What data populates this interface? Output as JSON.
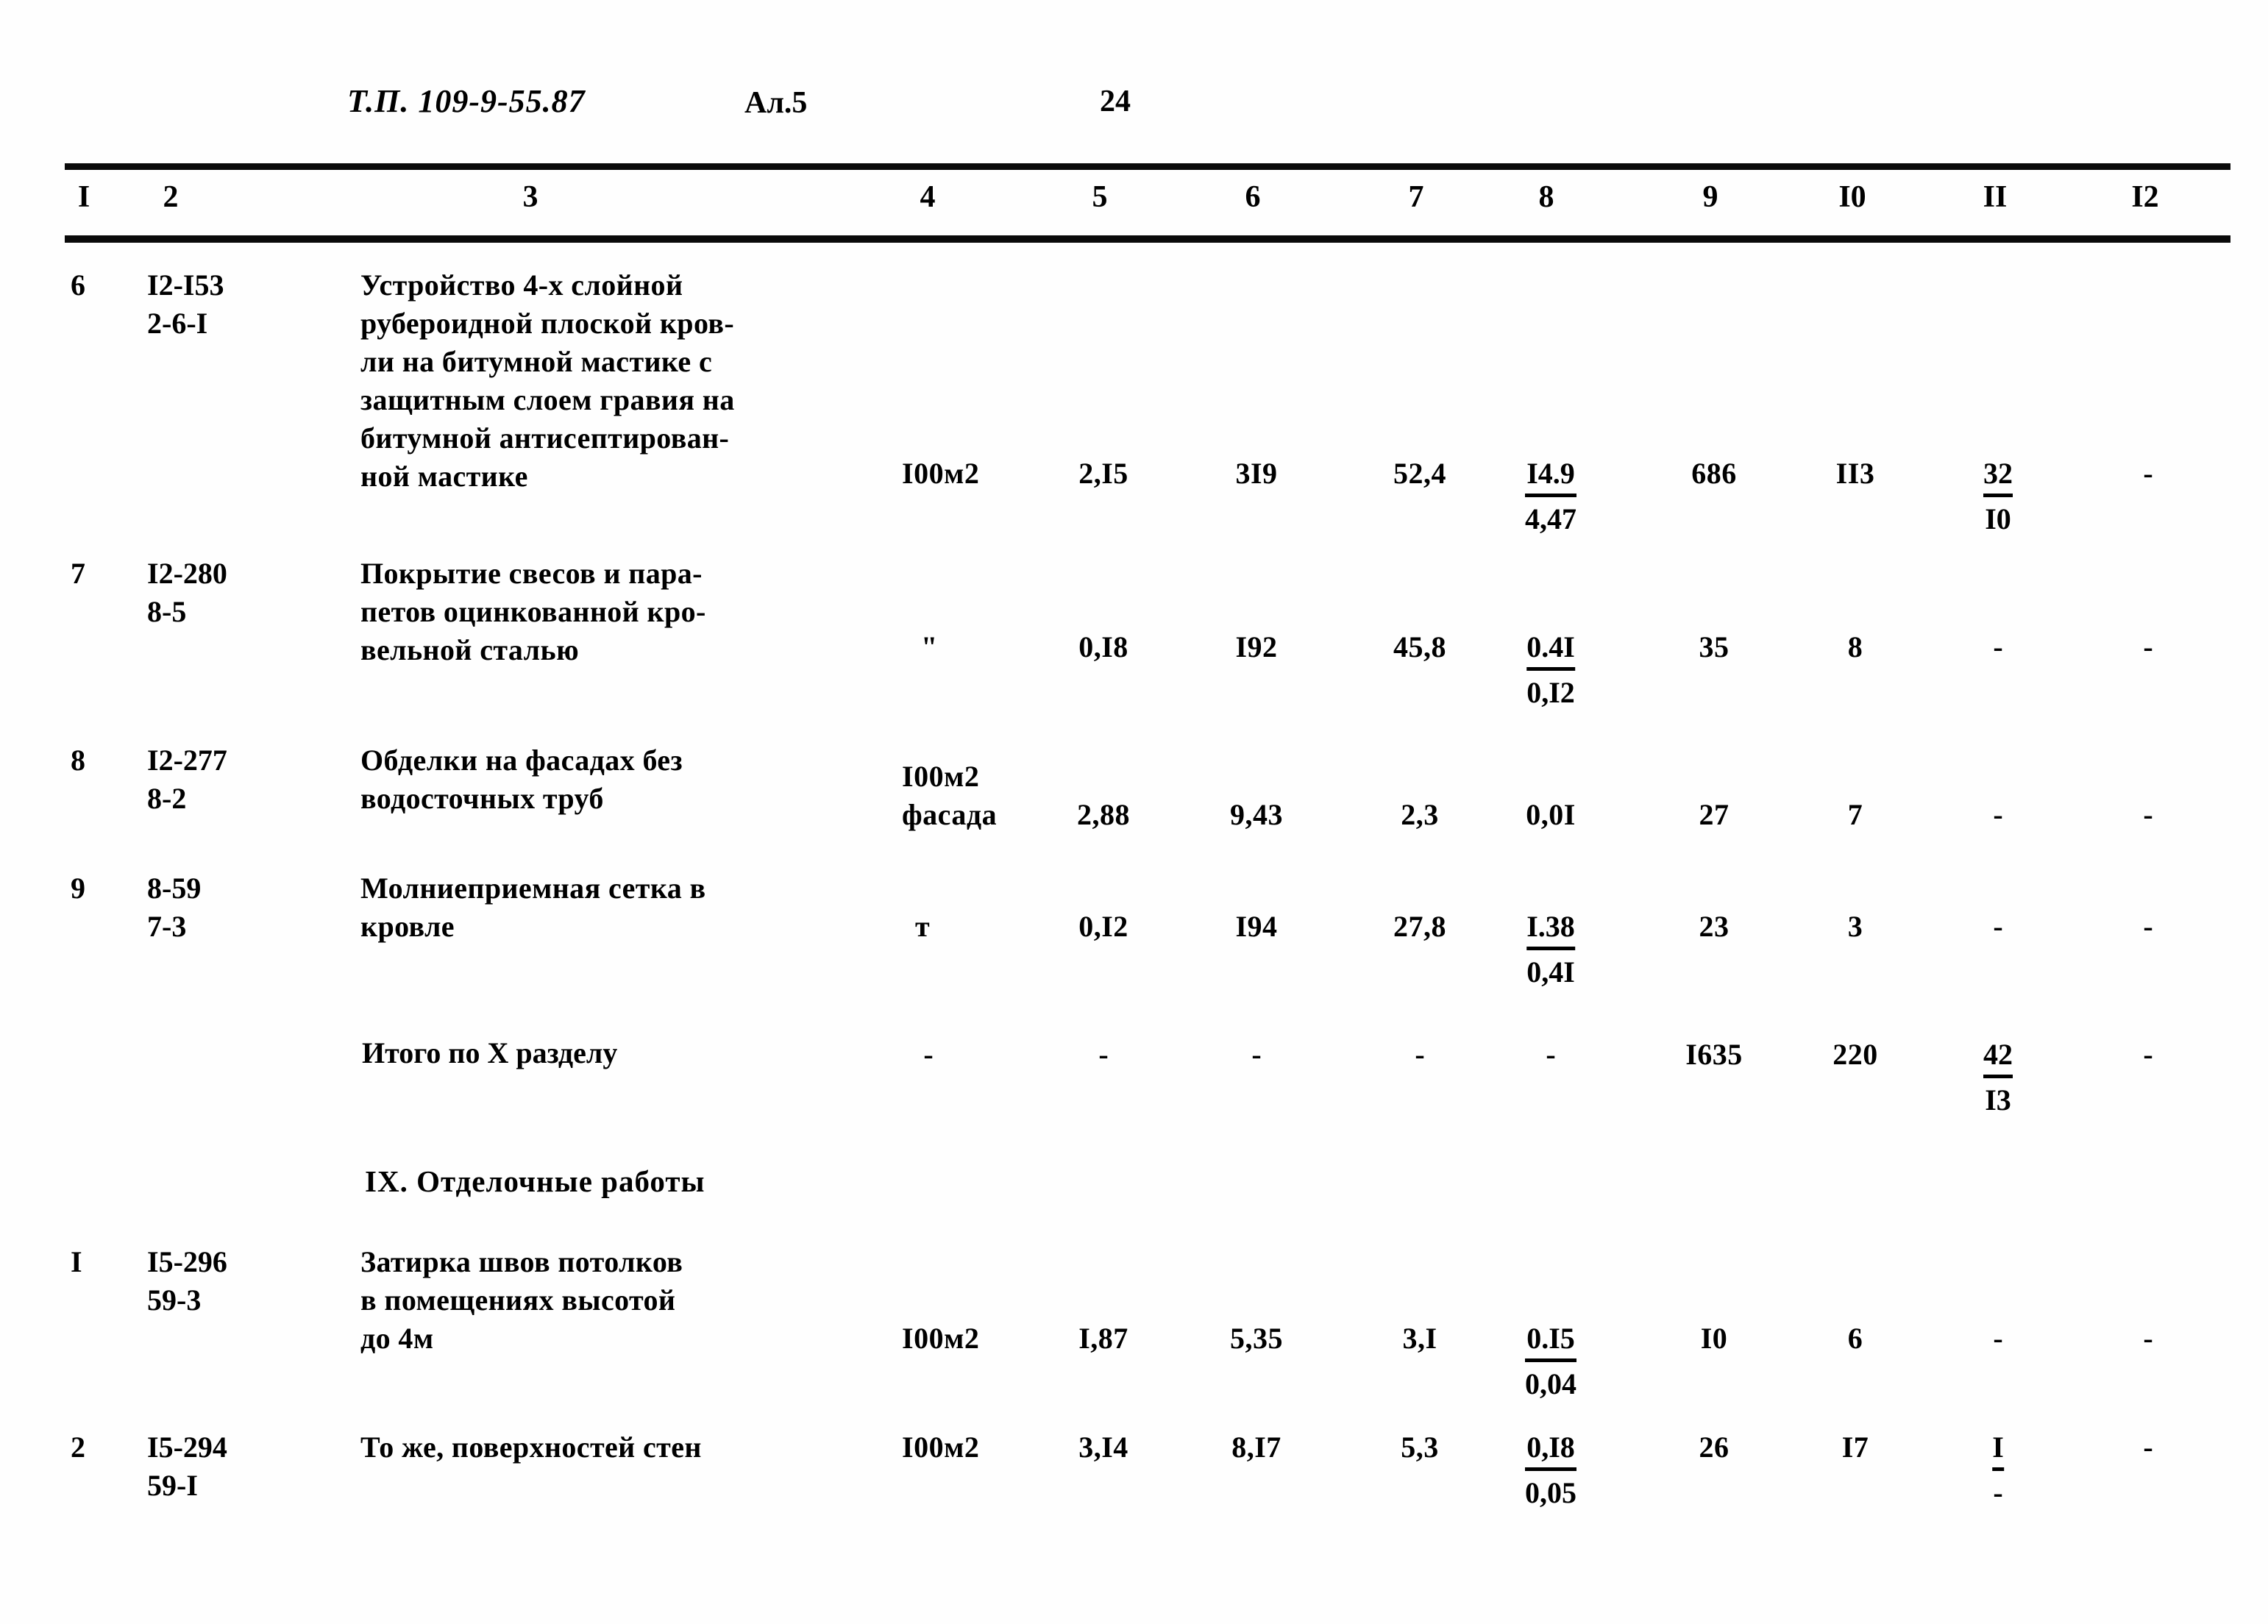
{
  "header": {
    "doc_code": "Т.П. 109-9-55.87",
    "album": "Ал.5",
    "page_number": "24"
  },
  "table": {
    "column_numbers": [
      "I",
      "2",
      "3",
      "4",
      "5",
      "6",
      "7",
      "8",
      "9",
      "I0",
      "II",
      "I2"
    ],
    "rows": [
      {
        "no": "6",
        "code": "I2-I53\n2-6-I",
        "description": "Устройство 4-х слойной\nрубероидной плоской кров-\nли на битумной мастике с\nзащитным слоем гравия на\nбитумной антисептирован-\nной мастике",
        "unit": "I00м2",
        "c5": "2,I5",
        "c6": "3I9",
        "c7": "52,4",
        "c8_top": "I4.9",
        "c8_bot": "4,47",
        "c9": "686",
        "c10": "II3",
        "c11_top": "32",
        "c11_bot": "I0",
        "c12": "-"
      },
      {
        "no": "7",
        "code": "I2-280\n8-5",
        "description": "Покрытие свесов и пара-\nпетов оцинкованной кро-\nвельной сталью",
        "unit": "\"",
        "c5": "0,I8",
        "c6": "I92",
        "c7": "45,8",
        "c8_top": "0.4I",
        "c8_bot": "0,I2",
        "c9": "35",
        "c10": "8",
        "c11": "-",
        "c12": "-"
      },
      {
        "no": "8",
        "code": "I2-277\n8-2",
        "description": "Обделки на фасадах без\nводосточных труб",
        "unit": "I00м2\nфасада",
        "c5": "2,88",
        "c6": "9,43",
        "c7": "2,3",
        "c8": "0,0I",
        "c9": "27",
        "c10": "7",
        "c11": "-",
        "c12": "-"
      },
      {
        "no": "9",
        "code": "8-59\n7-3",
        "description": "Молниеприемная сетка в\nкровле",
        "unit": "т",
        "c5": "0,I2",
        "c6": "I94",
        "c7": "27,8",
        "c8_top": "I.38",
        "c8_bot": "0,4I",
        "c9": "23",
        "c10": "3",
        "c11": "-",
        "c12": "-"
      }
    ],
    "total_row": {
      "label": "Итого по X разделу",
      "c4": "-",
      "c5": "-",
      "c6": "-",
      "c7": "-",
      "c8": "-",
      "c9": "I635",
      "c10": "220",
      "c11_top": "42",
      "c11_bot": "I3",
      "c12": "-"
    },
    "section_heading": "IX. Отделочные работы",
    "section_rows": [
      {
        "no": "I",
        "code": "I5-296\n59-3",
        "description": "Затирка швов потолков\nв помещениях высотой\nдо 4м",
        "unit": "I00м2",
        "c5": "I,87",
        "c6": "5,35",
        "c7": "3,I",
        "c8_top": "0.I5",
        "c8_bot": "0,04",
        "c9": "I0",
        "c10": "6",
        "c11": "-",
        "c12": "-"
      },
      {
        "no": "2",
        "code": "I5-294\n59-I",
        "description": "То же, поверхностей стен",
        "unit": "I00м2",
        "c5": "3,I4",
        "c6": "8,I7",
        "c7": "5,3",
        "c8_top": "0,I8",
        "c8_bot": "0,05",
        "c9": "26",
        "c10": "I7",
        "c11_top": "I",
        "c11_bot": "-",
        "c12": "-"
      }
    ]
  }
}
